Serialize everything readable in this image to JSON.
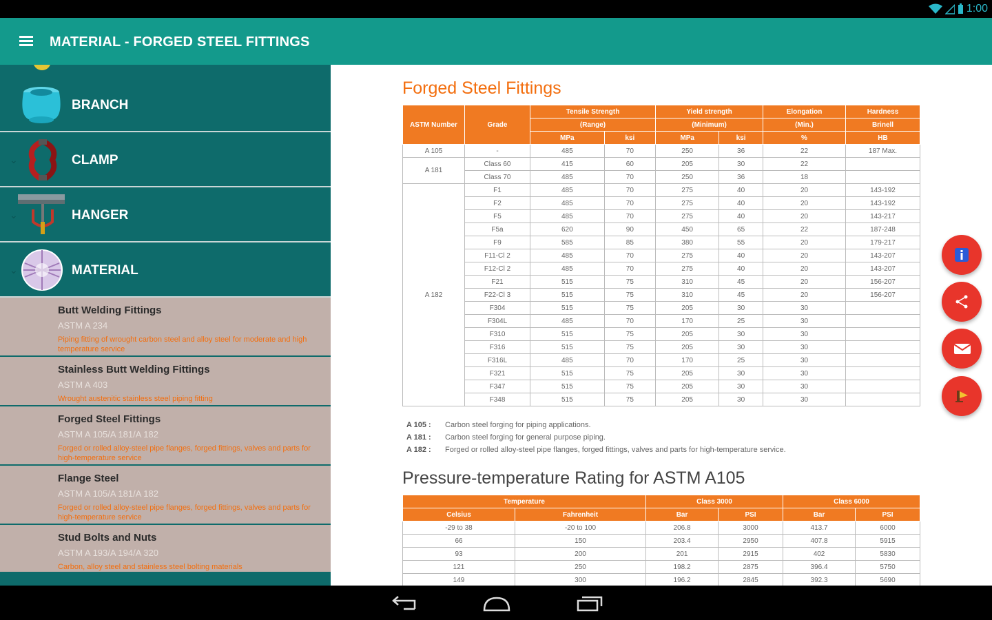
{
  "status": {
    "time": "1:00"
  },
  "appbar": {
    "title": "MATERIAL - FORGED STEEL FITTINGS"
  },
  "sidebar": {
    "categories": [
      {
        "label": "BRANCH",
        "icon": "branch-icon"
      },
      {
        "label": "CLAMP",
        "icon": "clamp-icon"
      },
      {
        "label": "HANGER",
        "icon": "hanger-icon"
      },
      {
        "label": "MATERIAL",
        "icon": "material-icon"
      }
    ],
    "items": [
      {
        "title": "Butt Welding Fittings",
        "std": "ASTM A 234",
        "desc": "Piping fitting of wrought carbon steel and alloy steel for moderate and high temperature service"
      },
      {
        "title": "Stainless Butt Welding Fittings",
        "std": "ASTM A 403",
        "desc": "Wrought austenitic stainless steel piping fitting"
      },
      {
        "title": "Forged Steel Fittings",
        "std": "ASTM A 105/A 181/A 182",
        "desc": "Forged or rolled alloy-steel pipe flanges, forged fittings, valves and parts for high-temperature service"
      },
      {
        "title": "Flange Steel",
        "std": "ASTM A 105/A 181/A 182",
        "desc": "Forged or rolled alloy-steel pipe flanges, forged fittings, valves and parts for high-temperature service"
      },
      {
        "title": "Stud Bolts and Nuts",
        "std": "ASTM A 193/A 194/A 320",
        "desc": "Carbon, alloy steel and stainless steel bolting materials"
      }
    ]
  },
  "content": {
    "title": "Forged Steel Fittings",
    "table1": {
      "headers": {
        "astm": "ASTM Number",
        "grade": "Grade",
        "tensile": "Tensile Strength",
        "tensile_sub": "(Range)",
        "yield": "Yield strength",
        "yield_sub": "(Minimum)",
        "elong": "Elongation",
        "elong_sub": "(Min.)",
        "elong_unit": "%",
        "hard": "Hardness",
        "hard_sub": "Brinell",
        "hard_unit": "HB",
        "mpa": "MPa",
        "ksi": "ksi"
      },
      "rows": [
        {
          "astm": "A 105",
          "grade": "-",
          "t_mpa": "485",
          "t_ksi": "70",
          "y_mpa": "250",
          "y_ksi": "36",
          "el": "22",
          "hb": "187 Max."
        },
        {
          "astm": "A 181",
          "grade": "Class 60",
          "t_mpa": "415",
          "t_ksi": "60",
          "y_mpa": "205",
          "y_ksi": "30",
          "el": "22",
          "hb": ""
        },
        {
          "astm": "",
          "grade": "Class 70",
          "t_mpa": "485",
          "t_ksi": "70",
          "y_mpa": "250",
          "y_ksi": "36",
          "el": "18",
          "hb": ""
        },
        {
          "astm": "A 182",
          "grade": "F1",
          "t_mpa": "485",
          "t_ksi": "70",
          "y_mpa": "275",
          "y_ksi": "40",
          "el": "20",
          "hb": "143-192"
        },
        {
          "astm": "",
          "grade": "F2",
          "t_mpa": "485",
          "t_ksi": "70",
          "y_mpa": "275",
          "y_ksi": "40",
          "el": "20",
          "hb": "143-192"
        },
        {
          "astm": "",
          "grade": "F5",
          "t_mpa": "485",
          "t_ksi": "70",
          "y_mpa": "275",
          "y_ksi": "40",
          "el": "20",
          "hb": "143-217"
        },
        {
          "astm": "",
          "grade": "F5a",
          "t_mpa": "620",
          "t_ksi": "90",
          "y_mpa": "450",
          "y_ksi": "65",
          "el": "22",
          "hb": "187-248"
        },
        {
          "astm": "",
          "grade": "F9",
          "t_mpa": "585",
          "t_ksi": "85",
          "y_mpa": "380",
          "y_ksi": "55",
          "el": "20",
          "hb": "179-217"
        },
        {
          "astm": "",
          "grade": "F11-Cl 2",
          "t_mpa": "485",
          "t_ksi": "70",
          "y_mpa": "275",
          "y_ksi": "40",
          "el": "20",
          "hb": "143-207"
        },
        {
          "astm": "",
          "grade": "F12-Cl 2",
          "t_mpa": "485",
          "t_ksi": "70",
          "y_mpa": "275",
          "y_ksi": "40",
          "el": "20",
          "hb": "143-207"
        },
        {
          "astm": "",
          "grade": "F21",
          "t_mpa": "515",
          "t_ksi": "75",
          "y_mpa": "310",
          "y_ksi": "45",
          "el": "20",
          "hb": "156-207"
        },
        {
          "astm": "",
          "grade": "F22-Cl 3",
          "t_mpa": "515",
          "t_ksi": "75",
          "y_mpa": "310",
          "y_ksi": "45",
          "el": "20",
          "hb": "156-207"
        },
        {
          "astm": "",
          "grade": "F304",
          "t_mpa": "515",
          "t_ksi": "75",
          "y_mpa": "205",
          "y_ksi": "30",
          "el": "30",
          "hb": ""
        },
        {
          "astm": "",
          "grade": "F304L",
          "t_mpa": "485",
          "t_ksi": "70",
          "y_mpa": "170",
          "y_ksi": "25",
          "el": "30",
          "hb": ""
        },
        {
          "astm": "",
          "grade": "F310",
          "t_mpa": "515",
          "t_ksi": "75",
          "y_mpa": "205",
          "y_ksi": "30",
          "el": "30",
          "hb": ""
        },
        {
          "astm": "",
          "grade": "F316",
          "t_mpa": "515",
          "t_ksi": "75",
          "y_mpa": "205",
          "y_ksi": "30",
          "el": "30",
          "hb": ""
        },
        {
          "astm": "",
          "grade": "F316L",
          "t_mpa": "485",
          "t_ksi": "70",
          "y_mpa": "170",
          "y_ksi": "25",
          "el": "30",
          "hb": ""
        },
        {
          "astm": "",
          "grade": "F321",
          "t_mpa": "515",
          "t_ksi": "75",
          "y_mpa": "205",
          "y_ksi": "30",
          "el": "30",
          "hb": ""
        },
        {
          "astm": "",
          "grade": "F347",
          "t_mpa": "515",
          "t_ksi": "75",
          "y_mpa": "205",
          "y_ksi": "30",
          "el": "30",
          "hb": ""
        },
        {
          "astm": "",
          "grade": "F348",
          "t_mpa": "515",
          "t_ksi": "75",
          "y_mpa": "205",
          "y_ksi": "30",
          "el": "30",
          "hb": ""
        }
      ]
    },
    "notes": [
      {
        "key": "A 105 :",
        "text": "Carbon steel forging for piping applications."
      },
      {
        "key": "A 181 :",
        "text": "Carbon steel forging for general purpose piping."
      },
      {
        "key": "A 182 :",
        "text": "Forged or rolled alloy-steel pipe flanges, forged fittings, valves and parts for high-temperature service."
      }
    ],
    "title2": "Pressure-temperature Rating for ASTM A105",
    "table2": {
      "headers": {
        "temp": "Temperature",
        "c3000": "Class 3000",
        "c6000": "Class 6000",
        "celsius": "Celsius",
        "fahr": "Fahrenheit",
        "bar": "Bar",
        "psi": "PSI"
      },
      "rows": [
        {
          "c": "-29 to 38",
          "f": "-20 to 100",
          "b3": "206.8",
          "p3": "3000",
          "b6": "413.7",
          "p6": "6000"
        },
        {
          "c": "66",
          "f": "150",
          "b3": "203.4",
          "p3": "2950",
          "b6": "407.8",
          "p6": "5915"
        },
        {
          "c": "93",
          "f": "200",
          "b3": "201",
          "p3": "2915",
          "b6": "402",
          "p6": "5830"
        },
        {
          "c": "121",
          "f": "250",
          "b3": "198.2",
          "p3": "2875",
          "b6": "396.4",
          "p6": "5750"
        },
        {
          "c": "149",
          "f": "300",
          "b3": "196.2",
          "p3": "2845",
          "b6": "392.3",
          "p6": "5690"
        }
      ]
    }
  },
  "fabs": [
    {
      "name": "info-fab",
      "icon": "info-icon"
    },
    {
      "name": "share-fab",
      "icon": "share-icon"
    },
    {
      "name": "email-fab",
      "icon": "email-icon"
    },
    {
      "name": "rate-fab",
      "icon": "rate-icon"
    }
  ],
  "colors": {
    "teal": "#139a8c",
    "dark_teal": "#0e6b6b",
    "orange": "#f07a22",
    "fab_red": "#e8352b"
  }
}
